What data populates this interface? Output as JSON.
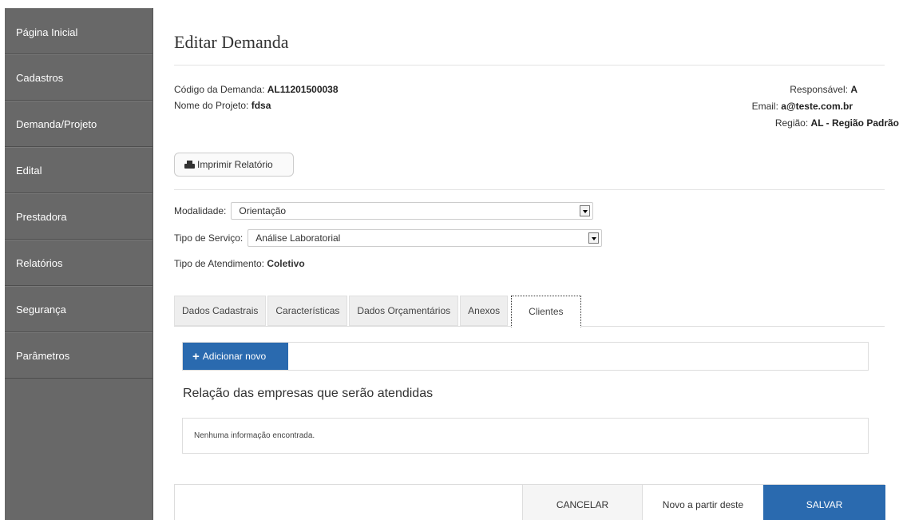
{
  "sidebar": {
    "items": [
      {
        "label": "Página Inicial"
      },
      {
        "label": "Cadastros"
      },
      {
        "label": "Demanda/Projeto"
      },
      {
        "label": "Edital"
      },
      {
        "label": "Prestadora"
      },
      {
        "label": "Relatórios"
      },
      {
        "label": "Segurança"
      },
      {
        "label": "Parâmetros"
      }
    ]
  },
  "page": {
    "title": "Editar Demanda"
  },
  "info": {
    "codigo_label": "Código da Demanda:",
    "codigo_value": "AL11201500038",
    "projeto_label": "Nome do Projeto:",
    "projeto_value": "fdsa",
    "responsavel_label": "Responsável:",
    "responsavel_value": "A",
    "email_label": "Email:",
    "email_value": "a@teste.com.br",
    "regiao_label": "Região:",
    "regiao_value": "AL - Região Padrão"
  },
  "actions": {
    "print_label": "Imprimir Relatório"
  },
  "form": {
    "modalidade_label": "Modalidade:",
    "modalidade_value": "Orientação",
    "tipo_servico_label": "Tipo de Serviço:",
    "tipo_servico_value": "Análise Laboratorial",
    "tipo_atendimento_label": "Tipo de Atendimento:",
    "tipo_atendimento_value": "Coletivo"
  },
  "tabs": [
    {
      "label": "Dados Cadastrais"
    },
    {
      "label": "Características"
    },
    {
      "label": "Dados Orçamentários"
    },
    {
      "label": "Anexos"
    },
    {
      "label": "Clientes"
    }
  ],
  "clientes": {
    "add_label": "Adicionar novo",
    "section_title": "Relação das empresas que serão atendidas",
    "empty_text": "Nenhuma informação encontrada."
  },
  "footer": {
    "cancel_label": "CANCELAR",
    "novo_label": "Novo a partir deste",
    "save_label": "SALVAR"
  },
  "colors": {
    "sidebar_bg": "#686868",
    "primary": "#2a6aaf"
  }
}
